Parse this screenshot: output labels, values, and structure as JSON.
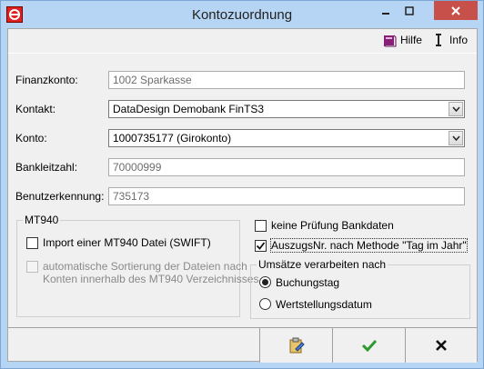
{
  "window": {
    "title": "Kontozuordnung"
  },
  "menu": {
    "help_label": "Hilfe",
    "info_label": "Info"
  },
  "form": {
    "finanzkonto": {
      "label": "Finanzkonto:",
      "value": "1002 Sparkasse"
    },
    "kontakt": {
      "label": "Kontakt:",
      "value": "DataDesign Demobank FinTS3"
    },
    "konto": {
      "label": "Konto:",
      "value": "1000735177 (Girokonto)"
    },
    "bankleitzahl": {
      "label": "Bankleitzahl:",
      "value": "70000999"
    },
    "benutzerkennung": {
      "label": "Benutzerkennung:",
      "value": "735173"
    }
  },
  "mt940": {
    "title": "MT940",
    "import_label": "Import einer MT940 Datei (SWIFT)",
    "import_checked": false,
    "sort_label_line1": "automatische Sortierung der Dateien nach",
    "sort_label_line2": "Konten innerhalb des MT940 Verzeichnisses",
    "sort_checked": false
  },
  "options": {
    "keine_pruefung_label": "keine Prüfung Bankdaten",
    "keine_pruefung_checked": false,
    "auszugs_label": "AuszugsNr. nach Methode \"Tag im Jahr\"",
    "auszugs_checked": true
  },
  "umsaetze": {
    "title": "Umsätze verarbeiten nach",
    "option1": "Buchungstag",
    "option2": "Wertstellungsdatum",
    "selected": "Buchungstag"
  },
  "icons": {
    "app": "app-logo-icon",
    "help": "help-book-icon",
    "info": "info-icon",
    "edit": "edit-clipboard-icon",
    "ok": "check-icon",
    "cancel": "cross-icon"
  },
  "colors": {
    "ok_green": "#2c9a2c",
    "close_red": "#c7504b"
  }
}
